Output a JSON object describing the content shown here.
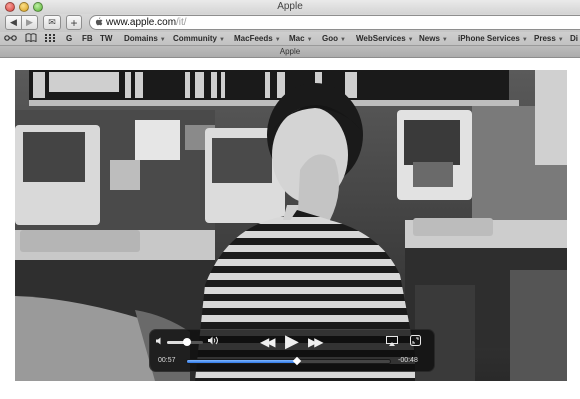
{
  "window": {
    "title": "Apple"
  },
  "toolbar": {
    "back_icon": "back-arrow-icon",
    "forward_icon": "forward-arrow-icon",
    "back_glyph": "◀",
    "forward_glyph": "▶",
    "mail_glyph": "✉",
    "new_tab_glyph": "+",
    "url_host": "www.apple.com",
    "url_path": "/it/"
  },
  "bookmarks": {
    "items": [
      {
        "label": "G"
      },
      {
        "label": "FB"
      },
      {
        "label": "TW"
      },
      {
        "label": "Domains",
        "menu": true
      },
      {
        "label": "Community",
        "menu": true
      },
      {
        "label": "MacFeeds",
        "menu": true
      },
      {
        "label": "Mac",
        "menu": true
      },
      {
        "label": "Goo",
        "menu": true
      },
      {
        "label": "WebServices",
        "menu": true
      },
      {
        "label": "News",
        "menu": true
      },
      {
        "label": "iPhone Services",
        "menu": true
      },
      {
        "label": "Press",
        "menu": true
      },
      {
        "label": "Di"
      }
    ],
    "arrow": "▼"
  },
  "tab": {
    "label": "Apple"
  },
  "player": {
    "elapsed": "00:57",
    "remaining": "-00:48",
    "progress": 0.54,
    "buffered": 0.72,
    "volume": 0.55,
    "rewind_glyph": "◀◀",
    "play_glyph": "▶",
    "forward_glyph": "▶▶"
  }
}
